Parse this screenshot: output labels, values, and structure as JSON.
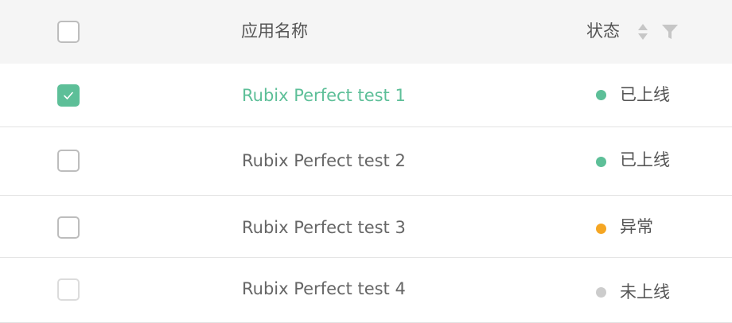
{
  "columns": {
    "name_title": "应用名称",
    "status_title": "状态"
  },
  "icons": {
    "sort": "sort-icon",
    "filter": "filter-icon",
    "check": "check-icon"
  },
  "colors": {
    "accent": "#5dbf98",
    "online": "#5dbf98",
    "error": "#f5a623",
    "offline": "#cccccc"
  },
  "rows": [
    {
      "name": "Rubix Perfect test 1",
      "status": "已上线",
      "status_color": "#5dbf98",
      "checked": true
    },
    {
      "name": "Rubix Perfect test 2",
      "status": "已上线",
      "status_color": "#5dbf98",
      "checked": false
    },
    {
      "name": "Rubix Perfect test 3",
      "status": "异常",
      "status_color": "#f5a623",
      "checked": false
    },
    {
      "name": "Rubix Perfect test 4",
      "status": "未上线",
      "status_color": "#cccccc",
      "checked": false
    }
  ]
}
